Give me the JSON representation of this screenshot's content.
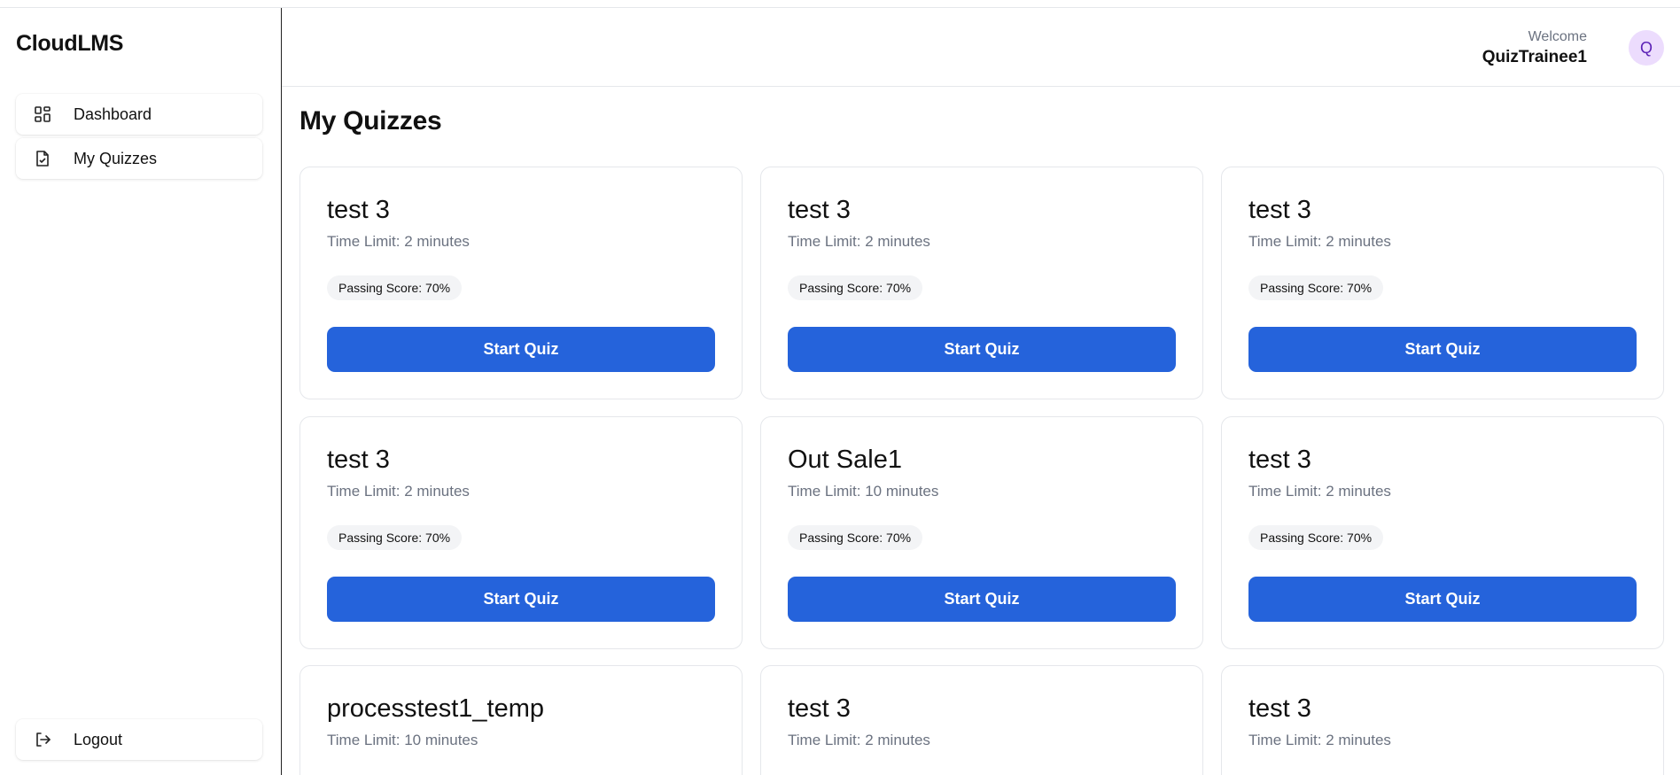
{
  "brand": "CloudLMS",
  "sidebar": {
    "items": [
      {
        "label": "Dashboard",
        "icon": "grid-icon"
      },
      {
        "label": "My Quizzes",
        "icon": "document-check-icon"
      }
    ],
    "logout": {
      "label": "Logout",
      "icon": "logout-icon"
    }
  },
  "header": {
    "welcome": "Welcome",
    "username": "QuizTrainee1",
    "avatar_initial": "Q",
    "avatar_bg": "#ecdcfd"
  },
  "page_title": "My Quizzes",
  "colors": {
    "primary": "#2563db"
  },
  "quizzes": [
    {
      "title": "test 3",
      "time_limit": "Time Limit: 2 minutes",
      "passing": "Passing Score: 70%",
      "button": "Start Quiz"
    },
    {
      "title": "test 3",
      "time_limit": "Time Limit: 2 minutes",
      "passing": "Passing Score: 70%",
      "button": "Start Quiz"
    },
    {
      "title": "test 3",
      "time_limit": "Time Limit: 2 minutes",
      "passing": "Passing Score: 70%",
      "button": "Start Quiz"
    },
    {
      "title": "test 3",
      "time_limit": "Time Limit: 2 minutes",
      "passing": "Passing Score: 70%",
      "button": "Start Quiz"
    },
    {
      "title": "Out Sale1",
      "time_limit": "Time Limit: 10 minutes",
      "passing": "Passing Score: 70%",
      "button": "Start Quiz"
    },
    {
      "title": "test 3",
      "time_limit": "Time Limit: 2 minutes",
      "passing": "Passing Score: 70%",
      "button": "Start Quiz"
    },
    {
      "title": "processtest1_temp",
      "time_limit": "Time Limit: 10 minutes"
    },
    {
      "title": "test 3",
      "time_limit": "Time Limit: 2 minutes"
    },
    {
      "title": "test 3",
      "time_limit": "Time Limit: 2 minutes"
    }
  ]
}
